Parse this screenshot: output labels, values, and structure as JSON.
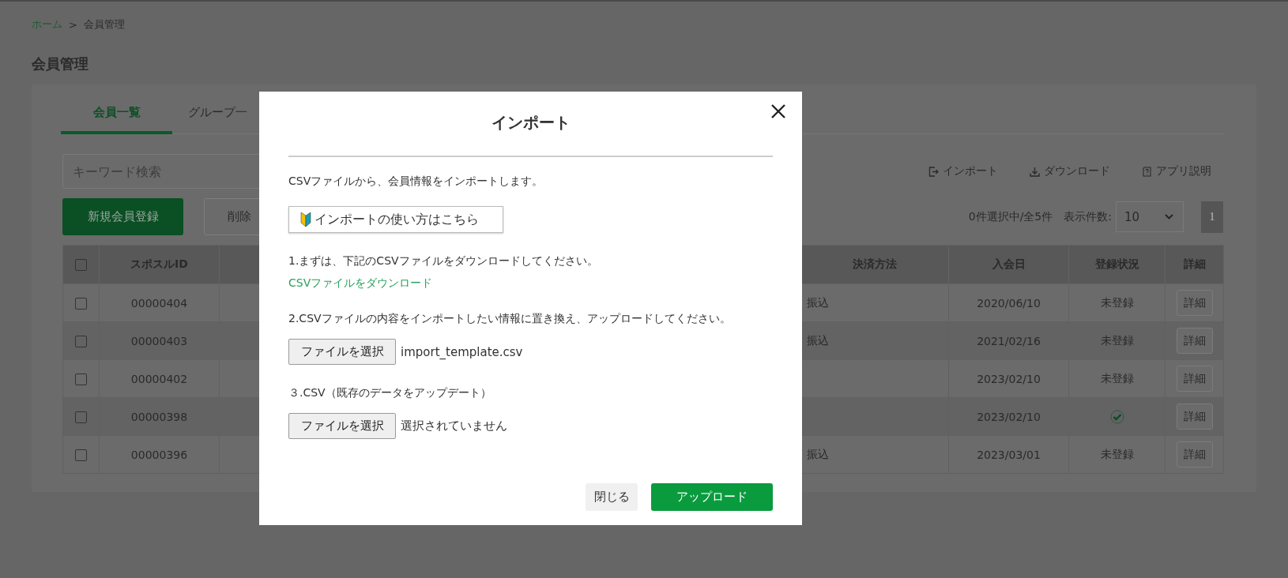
{
  "breadcrumb": [
    {
      "label": "ホーム",
      "kind": "link"
    },
    {
      "label": ">",
      "kind": "separator"
    },
    {
      "label": "会員管理",
      "kind": "current"
    }
  ],
  "page_title": "会員管理",
  "tabs": [
    {
      "label": "会員一覧",
      "selected": true
    },
    {
      "label": "グループ一",
      "selected": false
    }
  ],
  "search": {
    "placeholder": "キーワード検索"
  },
  "actions": [
    {
      "label": "新規会員登録",
      "kind": "primary"
    },
    {
      "label": "削除",
      "kind": "secondary"
    }
  ],
  "toolbar": [
    {
      "label": "インポート",
      "kind": "import"
    },
    {
      "label": "ダウンロード",
      "kind": "download"
    },
    {
      "label": "アプリ説明",
      "kind": "help"
    }
  ],
  "selection_count": "0件選択中/全5件",
  "page_size": {
    "label": "表示件数:",
    "value": "10"
  },
  "pagination": [
    {
      "label": "1",
      "selected": true
    }
  ],
  "table": {
    "header_checkbox": {
      "checked": false
    },
    "columns": [
      {
        "label": "スポスルID"
      },
      {},
      {
        "label": "決済方法"
      },
      {
        "label": "入会日"
      },
      {
        "label": "登録状況"
      },
      {
        "label": "詳細"
      }
    ],
    "rows": [
      {
        "checked": false,
        "id": "00000404",
        "payment": "振込",
        "date": "2020/06/10",
        "registered": false,
        "status": "未登録",
        "detail": "詳細"
      },
      {
        "checked": false,
        "id": "00000403",
        "payment": "振込",
        "date": "2021/02/16",
        "registered": false,
        "status": "未登録",
        "detail": "詳細"
      },
      {
        "checked": false,
        "id": "00000402",
        "date": "2023/02/10",
        "registered": false,
        "status": "未登録",
        "detail": "詳細"
      },
      {
        "checked": false,
        "id": "00000398",
        "date": "2023/02/10",
        "registered": true,
        "detail": "詳細"
      },
      {
        "checked": false,
        "id": "00000396",
        "payment": "振込",
        "date": "2023/03/01",
        "registered": false,
        "status": "未登録",
        "detail": "詳細"
      }
    ]
  },
  "modal": {
    "title": "インポート",
    "intro": "CSVファイルから、会員情報をインポートします。",
    "guide_button": "インポートの使い方はこちら",
    "steps": [
      {
        "kind": "download",
        "text": "1.まずは、下記のCSVファイルをダウンロードしてください。",
        "link": "CSVファイルをダウンロード"
      },
      {
        "kind": "upload",
        "text": "2.CSVファイルの内容をインポートしたい情報に置き換え、アップロードしてください。",
        "file_button": "ファイルを選択",
        "file_name": "import_template.csv"
      },
      {
        "kind": "upload",
        "text": "３.CSV（既存のデータをアップデート）",
        "file_button": "ファイルを選択",
        "file_name": "選択されていません"
      }
    ],
    "close_button": "閉じる",
    "upload_button": "アップロード"
  }
}
